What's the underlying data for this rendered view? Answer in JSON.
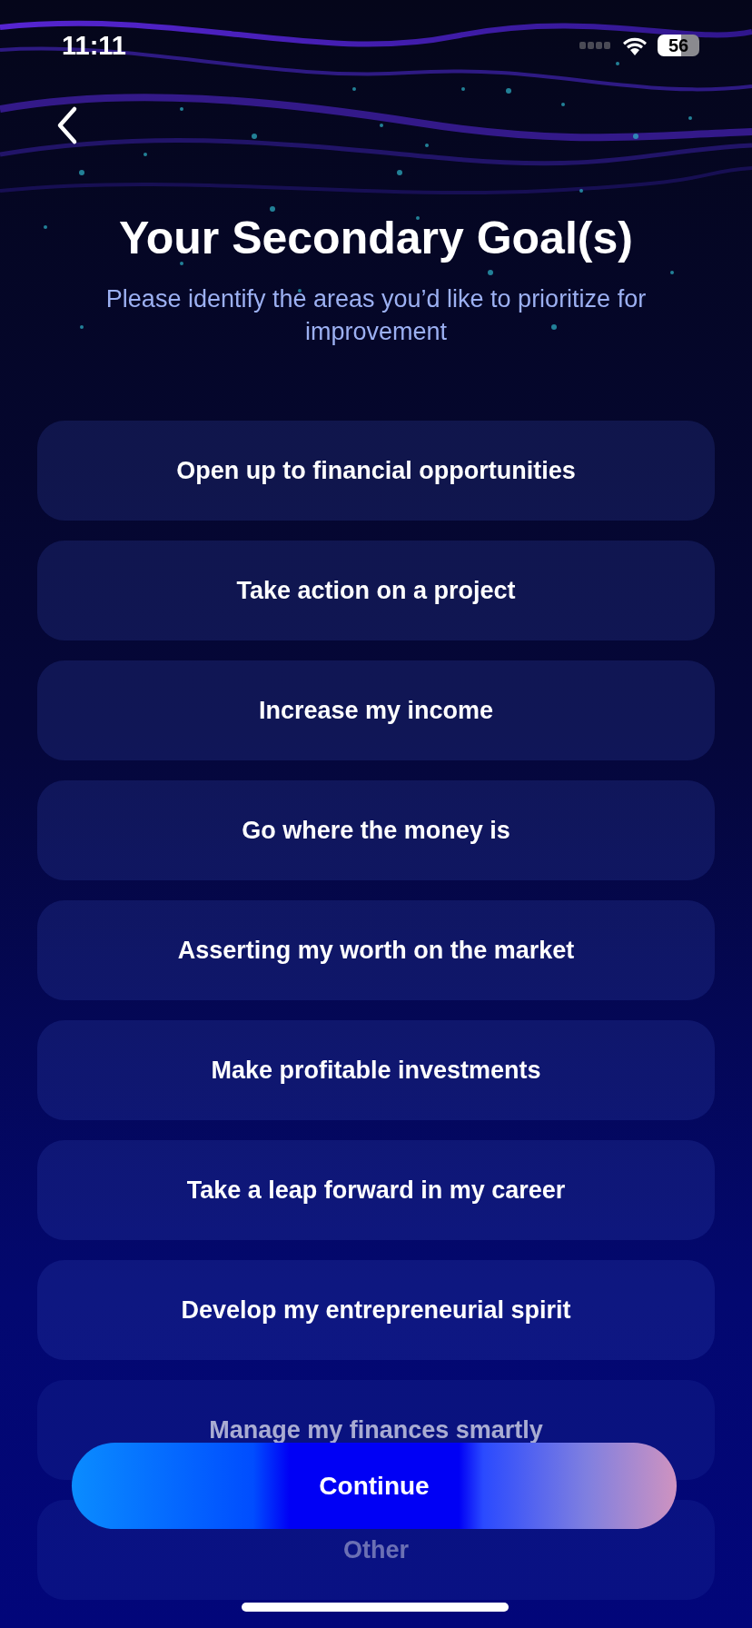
{
  "status_bar": {
    "time": "11:11",
    "battery": "56"
  },
  "title": "Your Secondary Goal(s)",
  "subtitle": "Please identify the areas you’d like to prioritize for improvement",
  "options": [
    {
      "label": "Open up to financial opportunities",
      "selected": false
    },
    {
      "label": "Take action on a project",
      "selected": false
    },
    {
      "label": "Increase my income",
      "selected": false
    },
    {
      "label": "Go where the money is",
      "selected": false
    },
    {
      "label": "Asserting my worth on the market",
      "selected": false
    },
    {
      "label": "Make profitable investments",
      "selected": false
    },
    {
      "label": "Take a leap forward in my career",
      "selected": false
    },
    {
      "label": "Develop my entrepreneurial spirit",
      "selected": false
    },
    {
      "label": "Manage my finances smartly",
      "selected": false
    },
    {
      "label": "Other",
      "selected": false
    }
  ],
  "continue_button": "Continue"
}
